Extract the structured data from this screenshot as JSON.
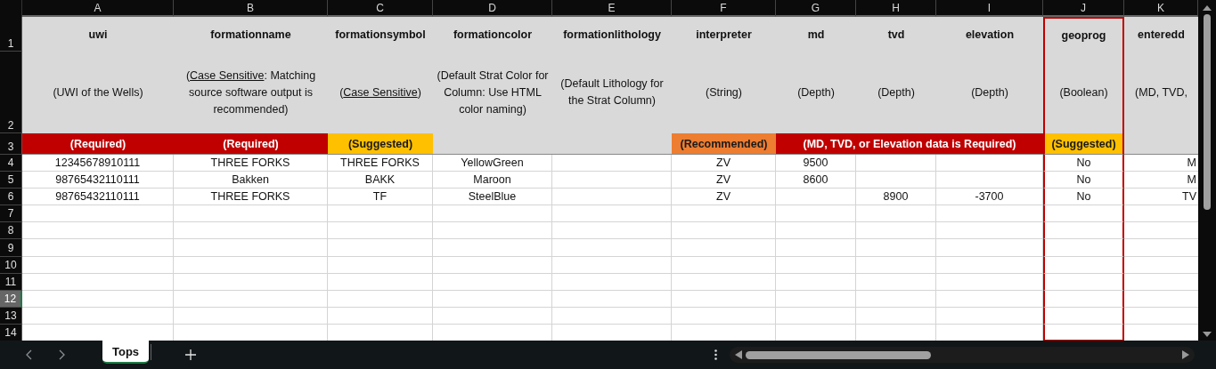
{
  "columns": [
    {
      "letter": "A",
      "name": "uwi",
      "description": [
        {
          "text": "(UWI of the Wells)"
        }
      ],
      "highlighted": false,
      "requirement": {
        "text": "(Required)",
        "color": "#c00000"
      }
    },
    {
      "letter": "B",
      "name": "formationname",
      "description": [
        {
          "text": "("
        },
        {
          "text": "Case Sensitive",
          "underline": true
        },
        {
          "text": ": Matching source software output is recommended)"
        }
      ],
      "highlighted": false,
      "requirement": {
        "text": "(Required)",
        "color": "#c00000"
      }
    },
    {
      "letter": "C",
      "name": "formationsymbol",
      "description": [
        {
          "text": "("
        },
        {
          "text": "Case Sensitive",
          "underline": true
        },
        {
          "text": ")"
        }
      ],
      "highlighted": false,
      "requirement": {
        "text": "(Suggested)",
        "color": "#ffc000"
      }
    },
    {
      "letter": "D",
      "name": "formationcolor",
      "description": [
        {
          "text": "(Default Strat Color for Column: Use HTML color naming)"
        }
      ],
      "highlighted": false
    },
    {
      "letter": "E",
      "name": "formationlithology",
      "description": [
        {
          "text": "(Default Lithology for the Strat Column)"
        }
      ],
      "highlighted": false
    },
    {
      "letter": "F",
      "name": "interpreter",
      "description": [
        {
          "text": "(String)"
        }
      ],
      "highlighted": false,
      "requirement": {
        "text": "(Recommended)",
        "color": "#ed7d31"
      }
    },
    {
      "letter": "G",
      "name": "md",
      "description": [
        {
          "text": "(Depth)"
        }
      ],
      "highlighted": false,
      "requirement": {
        "text": "(MD, TVD, or Elevation data is Required)",
        "color": "#c00000"
      }
    },
    {
      "letter": "H",
      "name": "tvd",
      "description": [
        {
          "text": "(Depth)"
        }
      ],
      "highlighted": false,
      "requirement": {
        "merged": true
      }
    },
    {
      "letter": "I",
      "name": "elevation",
      "description": [
        {
          "text": "(Depth)"
        }
      ],
      "highlighted": false,
      "requirement": {
        "merged": true
      }
    },
    {
      "letter": "J",
      "name": "geoprog",
      "description": [
        {
          "text": "(Boolean)"
        }
      ],
      "highlighted": true,
      "requirement": {
        "text": "(Suggested)",
        "color": "#ffc000"
      }
    },
    {
      "letter": "K",
      "name": "enteredd",
      "description": [
        {
          "text": "(MD, TVD,"
        }
      ],
      "highlighted": false
    }
  ],
  "row_headers": [
    {
      "label": "1",
      "selected": false
    },
    {
      "label": "2",
      "selected": false
    },
    {
      "label": "3",
      "selected": false
    },
    {
      "label": "4",
      "selected": false
    },
    {
      "label": "5",
      "selected": false
    },
    {
      "label": "6",
      "selected": false
    },
    {
      "label": "7",
      "selected": false
    },
    {
      "label": "8",
      "selected": false
    },
    {
      "label": "9",
      "selected": false
    },
    {
      "label": "10",
      "selected": false
    },
    {
      "label": "11",
      "selected": false
    },
    {
      "label": "12",
      "selected": true
    },
    {
      "label": "13",
      "selected": false
    },
    {
      "label": "14",
      "selected": false
    }
  ],
  "rows": [
    [
      "12345678910111",
      "THREE FORKS",
      "THREE FORKS",
      "YellowGreen",
      null,
      "ZV",
      "9500",
      null,
      null,
      "No",
      "M"
    ],
    [
      "98765432110111",
      "Bakken",
      "BAKK",
      "Maroon",
      null,
      "ZV",
      "8600",
      null,
      null,
      "No",
      "M"
    ],
    [
      "98765432110111",
      "THREE FORKS",
      "TF",
      "SteelBlue",
      null,
      "ZV",
      null,
      "8900",
      "-3700",
      "No",
      "TV"
    ],
    [],
    [],
    [],
    [],
    [],
    [],
    [],
    []
  ],
  "sheet_tabs": [
    {
      "label": "Tops",
      "selected": true
    }
  ]
}
